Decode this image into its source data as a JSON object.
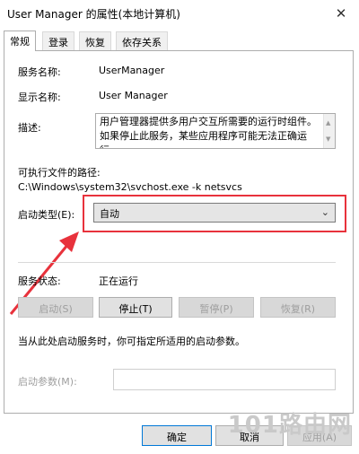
{
  "window": {
    "title": "User Manager 的属性(本地计算机)",
    "close_glyph": "✕"
  },
  "tabs": [
    {
      "label": "常规",
      "active": true
    },
    {
      "label": "登录",
      "active": false
    },
    {
      "label": "恢复",
      "active": false
    },
    {
      "label": "依存关系",
      "active": false
    }
  ],
  "general": {
    "service_name_label": "服务名称:",
    "service_name": "UserManager",
    "display_name_label": "显示名称:",
    "display_name": "User Manager",
    "description_label": "描述:",
    "description": "用户管理器提供多用户交互所需要的运行时组件。如果停止此服务，某些应用程序可能无法正确运行。",
    "exec_path_label": "可执行文件的路径:",
    "exec_path": "C:\\Windows\\system32\\svchost.exe -k netsvcs",
    "startup_type_label": "启动类型(E):",
    "startup_type": "自动",
    "service_status_label": "服务状态:",
    "service_status": "正在运行",
    "buttons": {
      "start": "启动(S)",
      "stop": "停止(T)",
      "pause": "暂停(P)",
      "resume": "恢复(R)"
    },
    "hint": "当从此处启动服务时，你可指定所适用的启动参数。",
    "start_params_label": "启动参数(M):",
    "start_params_value": ""
  },
  "footer": {
    "ok": "确定",
    "cancel": "取消",
    "apply": "应用(A)"
  },
  "watermark": "101路由网",
  "colors": {
    "highlight_red": "#e8323c",
    "accent_blue": "#0078d7"
  }
}
